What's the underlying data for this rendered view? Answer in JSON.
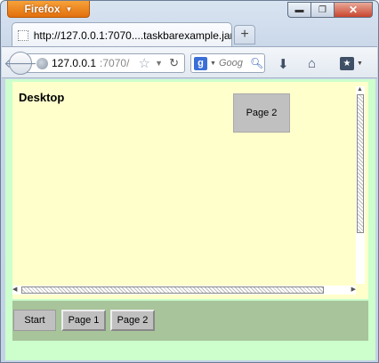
{
  "browser": {
    "app_button": "Firefox",
    "tab_title": "http://127.0.0.1:7070....taskbarexample.jar/",
    "new_tab_label": "+",
    "url_host": "127.0.0.1",
    "url_rest": ":7070/",
    "search_placeholder": "Goog",
    "search_engine_letter": "g",
    "window_controls": {
      "minimize": "▭",
      "maximize": "▢",
      "close": "✕"
    }
  },
  "page": {
    "desktop_title": "Desktop",
    "floating_window_title": "Page 2",
    "taskbar": {
      "buttons": [
        "Start",
        "Page 1",
        "Page 2"
      ]
    }
  },
  "colors": {
    "desktop_bg": "#ffffcc",
    "page_bg": "#ccffcc",
    "taskbar_bg": "#a8c49a",
    "button_bg": "#c0c0c0",
    "firefox_orange": "#e2700d"
  }
}
